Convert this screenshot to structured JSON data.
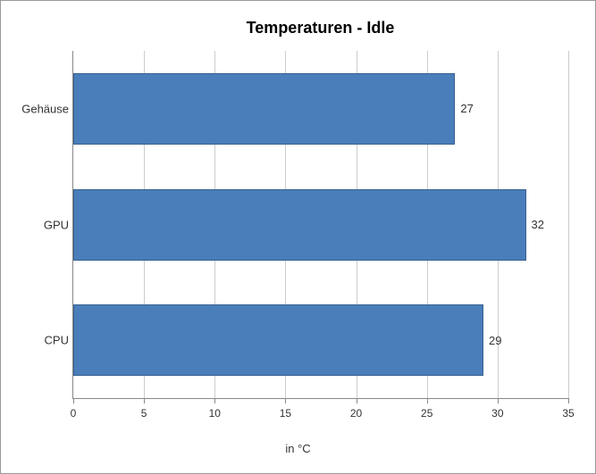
{
  "chart_data": {
    "type": "bar",
    "orientation": "horizontal",
    "title": "Temperaturen - Idle",
    "categories": [
      "Gehäuse",
      "GPU",
      "CPU"
    ],
    "values": [
      27,
      32,
      29
    ],
    "xlabel": "in °C",
    "ylabel": "",
    "xlim": [
      0,
      35
    ],
    "xticks": [
      0,
      5,
      10,
      15,
      20,
      25,
      30,
      35
    ],
    "bar_color": "#4a7ebb"
  }
}
